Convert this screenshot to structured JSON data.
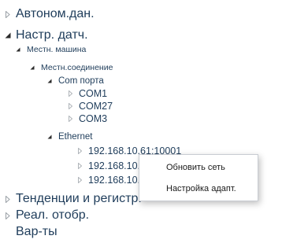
{
  "tree": {
    "root_autonomous": {
      "label": "Автоном.дан.",
      "expanded": false
    },
    "root_sensor_settings": {
      "label": "Настр. датч.",
      "expanded": true
    },
    "local_machine": {
      "label": "Местн. машина",
      "expanded": true
    },
    "local_connection": {
      "label": "Местн.соединение",
      "expanded": true
    },
    "com_ports": {
      "label": "Com порта",
      "expanded": true
    },
    "com1": {
      "label": "COM1"
    },
    "com27": {
      "label": "COM27"
    },
    "com3": {
      "label": "COM3"
    },
    "ethernet": {
      "label": "Ethernet",
      "expanded": true
    },
    "ip1": {
      "label": "192.168.10.61:10001"
    },
    "ip2": {
      "label": "192.168.10.150:10001"
    },
    "ip3": {
      "label": "192.168.10.91:10001"
    },
    "root_trends": {
      "label": "Тенденции и регистр.",
      "expanded": false
    },
    "root_realtime": {
      "label": "Реал. отобр.",
      "expanded": false
    },
    "root_variants": {
      "label": "Вар-ты"
    }
  },
  "context_menu": {
    "items": [
      "Обновить сеть",
      "Настройка адапт."
    ]
  },
  "icons": {
    "collapsed": "triangle-right-outline-icon",
    "expanded": "triangle-down-filled-icon"
  },
  "colors": {
    "tree_text": "#1e3c5a",
    "arrow": "#9aa0a6",
    "arrow_expanded": "#2b2b2b",
    "menu_border": "#c8ccd2"
  }
}
